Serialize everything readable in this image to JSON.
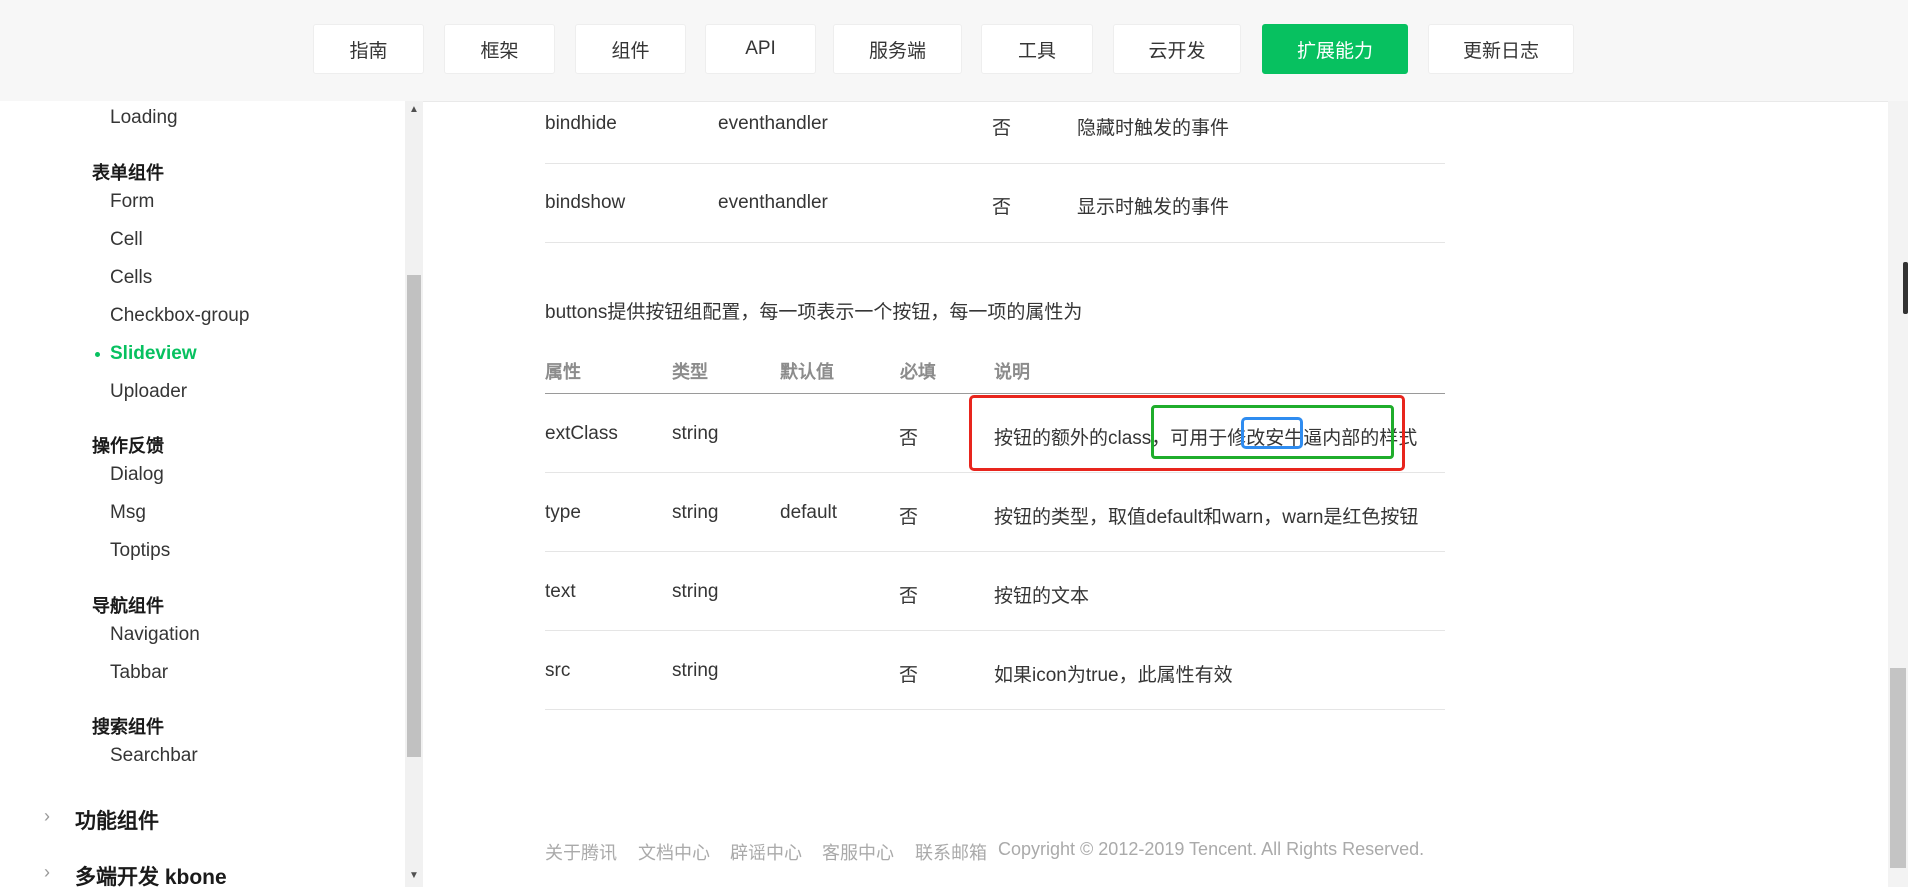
{
  "nav": {
    "tabs": [
      "指南",
      "框架",
      "组件",
      "API",
      "服务端",
      "工具",
      "云开发",
      "扩展能力",
      "更新日志"
    ],
    "active": "扩展能力",
    "accent": "#07c160"
  },
  "sidebar": {
    "top_item": "Loading",
    "groups": [
      {
        "title": "表单组件",
        "items": [
          "Form",
          "Cell",
          "Cells",
          "Checkbox-group",
          "Slideview",
          "Uploader"
        ]
      },
      {
        "title": "操作反馈",
        "items": [
          "Dialog",
          "Msg",
          "Toptips"
        ]
      },
      {
        "title": "导航组件",
        "items": [
          "Navigation",
          "Tabbar"
        ]
      },
      {
        "title": "搜索组件",
        "items": [
          "Searchbar"
        ]
      }
    ],
    "active_item": "Slideview",
    "categories": [
      "功能组件",
      "多端开发 kbone"
    ]
  },
  "events_table": {
    "rows": [
      {
        "name": "bindhide",
        "type": "eventhandler",
        "required": "否",
        "desc": "隐藏时触发的事件"
      },
      {
        "name": "bindshow",
        "type": "eventhandler",
        "required": "否",
        "desc": "显示时触发的事件"
      }
    ]
  },
  "intro": "buttons提供按钮组配置，每一项表示一个按钮，每一项的属性为",
  "buttons_table": {
    "headers": [
      "属性",
      "类型",
      "默认值",
      "必填",
      "说明"
    ],
    "rows": [
      {
        "attr": "extClass",
        "type": "string",
        "default": "",
        "required": "否",
        "desc": "按钮的额外的class，可用于修改安牛逼内部的样式"
      },
      {
        "attr": "type",
        "type": "string",
        "default": "default",
        "required": "否",
        "desc": "按钮的类型，取值default和warn，warn是红色按钮"
      },
      {
        "attr": "text",
        "type": "string",
        "default": "",
        "required": "否",
        "desc": "按钮的文本"
      },
      {
        "attr": "src",
        "type": "string",
        "default": "",
        "required": "否",
        "desc": "如果icon为true，此属性有效"
      }
    ]
  },
  "footer": {
    "links": [
      "关于腾讯",
      "文档中心",
      "辟谣中心",
      "客服中心",
      "联系邮箱"
    ],
    "copyright": "Copyright © 2012-2019 Tencent. All Rights Reserved."
  }
}
